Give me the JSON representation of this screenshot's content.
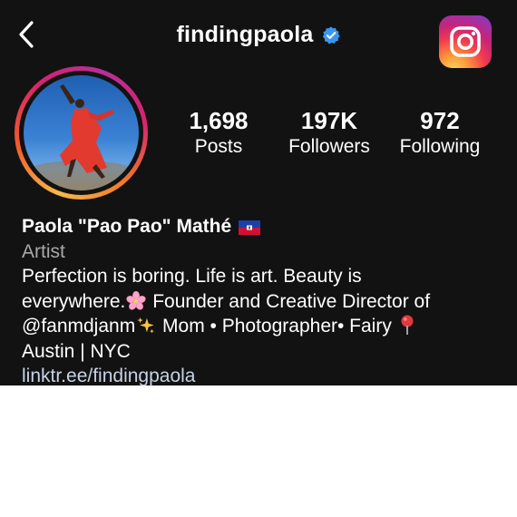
{
  "header": {
    "username": "findingpaola",
    "back_icon": "chevron-left-icon",
    "verified_icon": "verified-badge-icon",
    "logo_icon": "instagram-logo-icon"
  },
  "stats": {
    "posts": {
      "value": "1,698",
      "label": "Posts"
    },
    "followers": {
      "value": "197K",
      "label": "Followers"
    },
    "following": {
      "value": "972",
      "label": "Following"
    }
  },
  "profile": {
    "name": "Paola \"Pao Pao\" Mathé",
    "name_flag_icon": "haiti-flag-icon",
    "category": "Artist",
    "bio_line1": "Perfection is boring. Life is art. Beauty is",
    "bio_line2_a": "everywhere.",
    "bio_line2_b": " Founder and Creative Director of",
    "bio_line3_mention": "@fanmdjanm",
    "bio_line3_rest": " Mom • Photographer• Fairy",
    "bio_line4": "Austin | NYC",
    "link": "linktr.ee/findingpaola",
    "emoji_icons": [
      "cherry-blossom-icon",
      "sparkles-icon",
      "pin-icon"
    ]
  },
  "colors": {
    "background": "#121212",
    "secondary_text": "#a8a8a8",
    "link": "#c7d2e6",
    "verified": "#3897f0"
  }
}
